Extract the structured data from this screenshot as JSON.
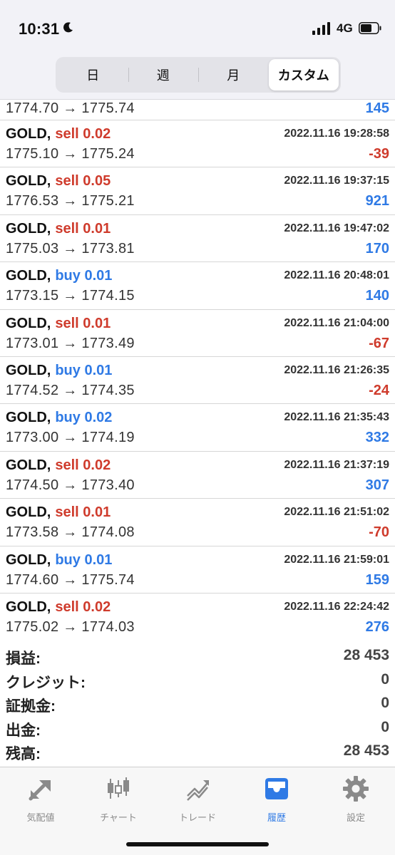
{
  "status": {
    "time": "10:31",
    "network": "4G"
  },
  "segments": [
    {
      "label": "日"
    },
    {
      "label": "週"
    },
    {
      "label": "月"
    },
    {
      "label": "カスタム"
    }
  ],
  "partial_row": {
    "prices": "1774.70 → 1775.74",
    "profit": "145"
  },
  "trades": [
    {
      "symbol": "GOLD,",
      "side": "sell 0.02",
      "datetime": "2022.11.16 19:28:58",
      "prices": "1775.10 → 1775.24",
      "profit": "-39"
    },
    {
      "symbol": "GOLD,",
      "side": "sell 0.05",
      "datetime": "2022.11.16 19:37:15",
      "prices": "1776.53 → 1775.21",
      "profit": "921"
    },
    {
      "symbol": "GOLD,",
      "side": "sell 0.01",
      "datetime": "2022.11.16 19:47:02",
      "prices": "1775.03 → 1773.81",
      "profit": "170"
    },
    {
      "symbol": "GOLD,",
      "side": "buy 0.01",
      "datetime": "2022.11.16 20:48:01",
      "prices": "1773.15 → 1774.15",
      "profit": "140"
    },
    {
      "symbol": "GOLD,",
      "side": "sell 0.01",
      "datetime": "2022.11.16 21:04:00",
      "prices": "1773.01 → 1773.49",
      "profit": "-67"
    },
    {
      "symbol": "GOLD,",
      "side": "buy 0.01",
      "datetime": "2022.11.16 21:26:35",
      "prices": "1774.52 → 1774.35",
      "profit": "-24"
    },
    {
      "symbol": "GOLD,",
      "side": "buy 0.02",
      "datetime": "2022.11.16 21:35:43",
      "prices": "1773.00 → 1774.19",
      "profit": "332"
    },
    {
      "symbol": "GOLD,",
      "side": "sell 0.02",
      "datetime": "2022.11.16 21:37:19",
      "prices": "1774.50 → 1773.40",
      "profit": "307"
    },
    {
      "symbol": "GOLD,",
      "side": "sell 0.01",
      "datetime": "2022.11.16 21:51:02",
      "prices": "1773.58 → 1774.08",
      "profit": "-70"
    },
    {
      "symbol": "GOLD,",
      "side": "buy 0.01",
      "datetime": "2022.11.16 21:59:01",
      "prices": "1774.60 → 1775.74",
      "profit": "159"
    },
    {
      "symbol": "GOLD,",
      "side": "sell 0.02",
      "datetime": "2022.11.16 22:24:42",
      "prices": "1775.02 → 1774.03",
      "profit": "276"
    }
  ],
  "summary": [
    {
      "label": "損益:",
      "value": "28 453"
    },
    {
      "label": "クレジット:",
      "value": "0"
    },
    {
      "label": "証拠金:",
      "value": "0"
    },
    {
      "label": "出金:",
      "value": "0"
    },
    {
      "label": "残高:",
      "value": "28 453"
    }
  ],
  "tabs": [
    {
      "label": "気配値",
      "icon": "quotes-icon"
    },
    {
      "label": "チャート",
      "icon": "chart-icon"
    },
    {
      "label": "トレード",
      "icon": "trade-icon"
    },
    {
      "label": "履歴",
      "icon": "history-icon"
    },
    {
      "label": "設定",
      "icon": "settings-icon"
    }
  ],
  "colors": {
    "sell": "#cf3b2c",
    "buy": "#2f7ae5",
    "positive": "#2f7ae5",
    "negative": "#cf3b2c",
    "active_tab": "#2f7ae5"
  }
}
